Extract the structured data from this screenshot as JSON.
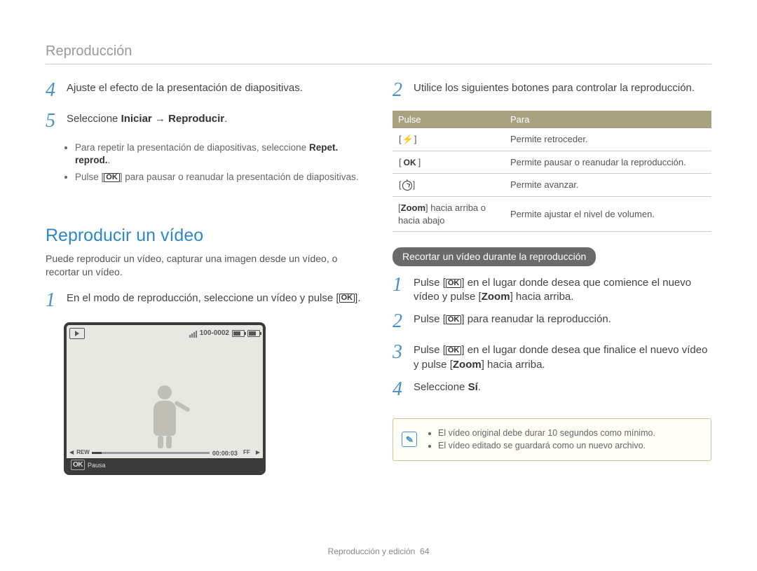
{
  "header": {
    "title": "Reproducción"
  },
  "left": {
    "step4": "Ajuste el efecto de la presentación de diapositivas.",
    "step5_a": "Seleccione ",
    "step5_b": "Iniciar",
    "step5_arrow": " → ",
    "step5_c": "Reproducir",
    "step5_end": ".",
    "bullet1_a": "Para repetir la presentación de diapositivas, seleccione ",
    "bullet1_b": "Repet. reprod.",
    "bullet1_c": ".",
    "bullet2_a": "Pulse [",
    "bullet2_b": "] para pausar o reanudar la presentación de diapositivas.",
    "section_title": "Reproducir un vídeo",
    "section_desc": "Puede reproducir un vídeo, capturar una imagen desde un vídeo, o recortar un vídeo.",
    "play_step1_a": "En el modo de reproducción, seleccione un vídeo y pulse [",
    "play_step1_b": "].",
    "screen": {
      "counter": "100-0002",
      "rew": "REW",
      "ff": "FF",
      "time": "00:00:03",
      "pause": "Pausa"
    }
  },
  "right": {
    "step2": "Utilice los siguientes botones para controlar la reproducción.",
    "table": {
      "h1": "Pulse",
      "h2": "Para",
      "r1v": "Permite retroceder.",
      "r2v": "Permite pausar o reanudar la reproducción.",
      "r3v": "Permite avanzar.",
      "r4k_a": "[",
      "r4k_b": "Zoom",
      "r4k_c": "] hacia arriba o hacia abajo",
      "r4v": "Permite ajustar el nivel de volumen."
    },
    "pill": "Recortar un vídeo durante la reproducción",
    "t1_a": "Pulse [",
    "t1_b": "] en el lugar donde desea que comience el nuevo vídeo y pulse [",
    "t1_zoom": "Zoom",
    "t1_c": "] hacia arriba.",
    "t2_a": "Pulse [",
    "t2_b": "] para reanudar la reproducción.",
    "t3_a": "Pulse [",
    "t3_b": "] en el lugar donde desea que finalice el nuevo vídeo y pulse [",
    "t3_zoom": "Zoom",
    "t3_c": "] hacia arriba.",
    "t4_a": "Seleccione ",
    "t4_b": "Sí",
    "t4_c": ".",
    "note1": "El vídeo original debe durar 10 segundos como mínimo.",
    "note2": "El vídeo editado se guardará como un nuevo archivo."
  },
  "ok_label": "OK",
  "footer": {
    "section": "Reproducción y edición",
    "page": "64"
  }
}
